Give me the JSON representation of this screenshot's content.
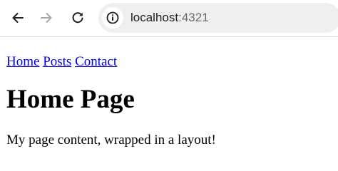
{
  "browser": {
    "url_host": "localhost",
    "url_port": ":4321"
  },
  "nav": {
    "links": [
      "Home",
      "Posts",
      "Contact"
    ]
  },
  "page": {
    "title": "Home Page",
    "content": "My page content, wrapped in a layout!"
  }
}
